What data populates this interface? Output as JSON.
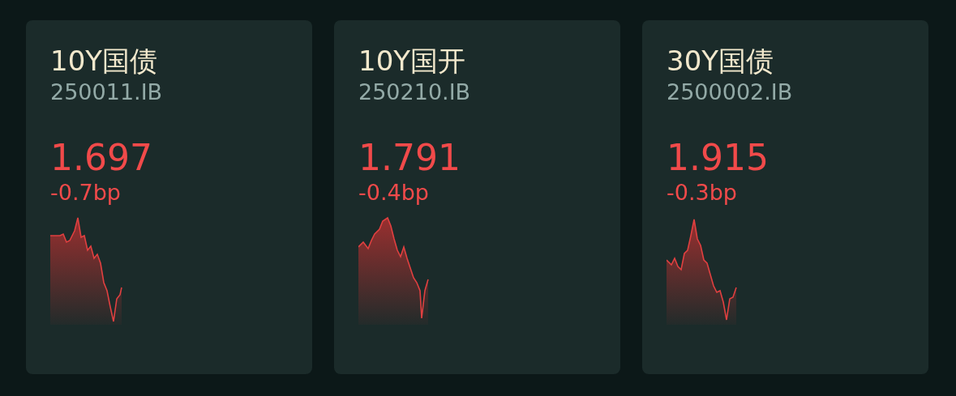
{
  "cards": [
    {
      "title": "10Y国债",
      "code": "250011.IB",
      "value": "1.697",
      "change": "-0.7bp"
    },
    {
      "title": "10Y国开",
      "code": "250210.IB",
      "value": "1.791",
      "change": "-0.4bp"
    },
    {
      "title": "30Y国债",
      "code": "2500002.IB",
      "value": "1.915",
      "change": "-0.3bp"
    }
  ]
}
